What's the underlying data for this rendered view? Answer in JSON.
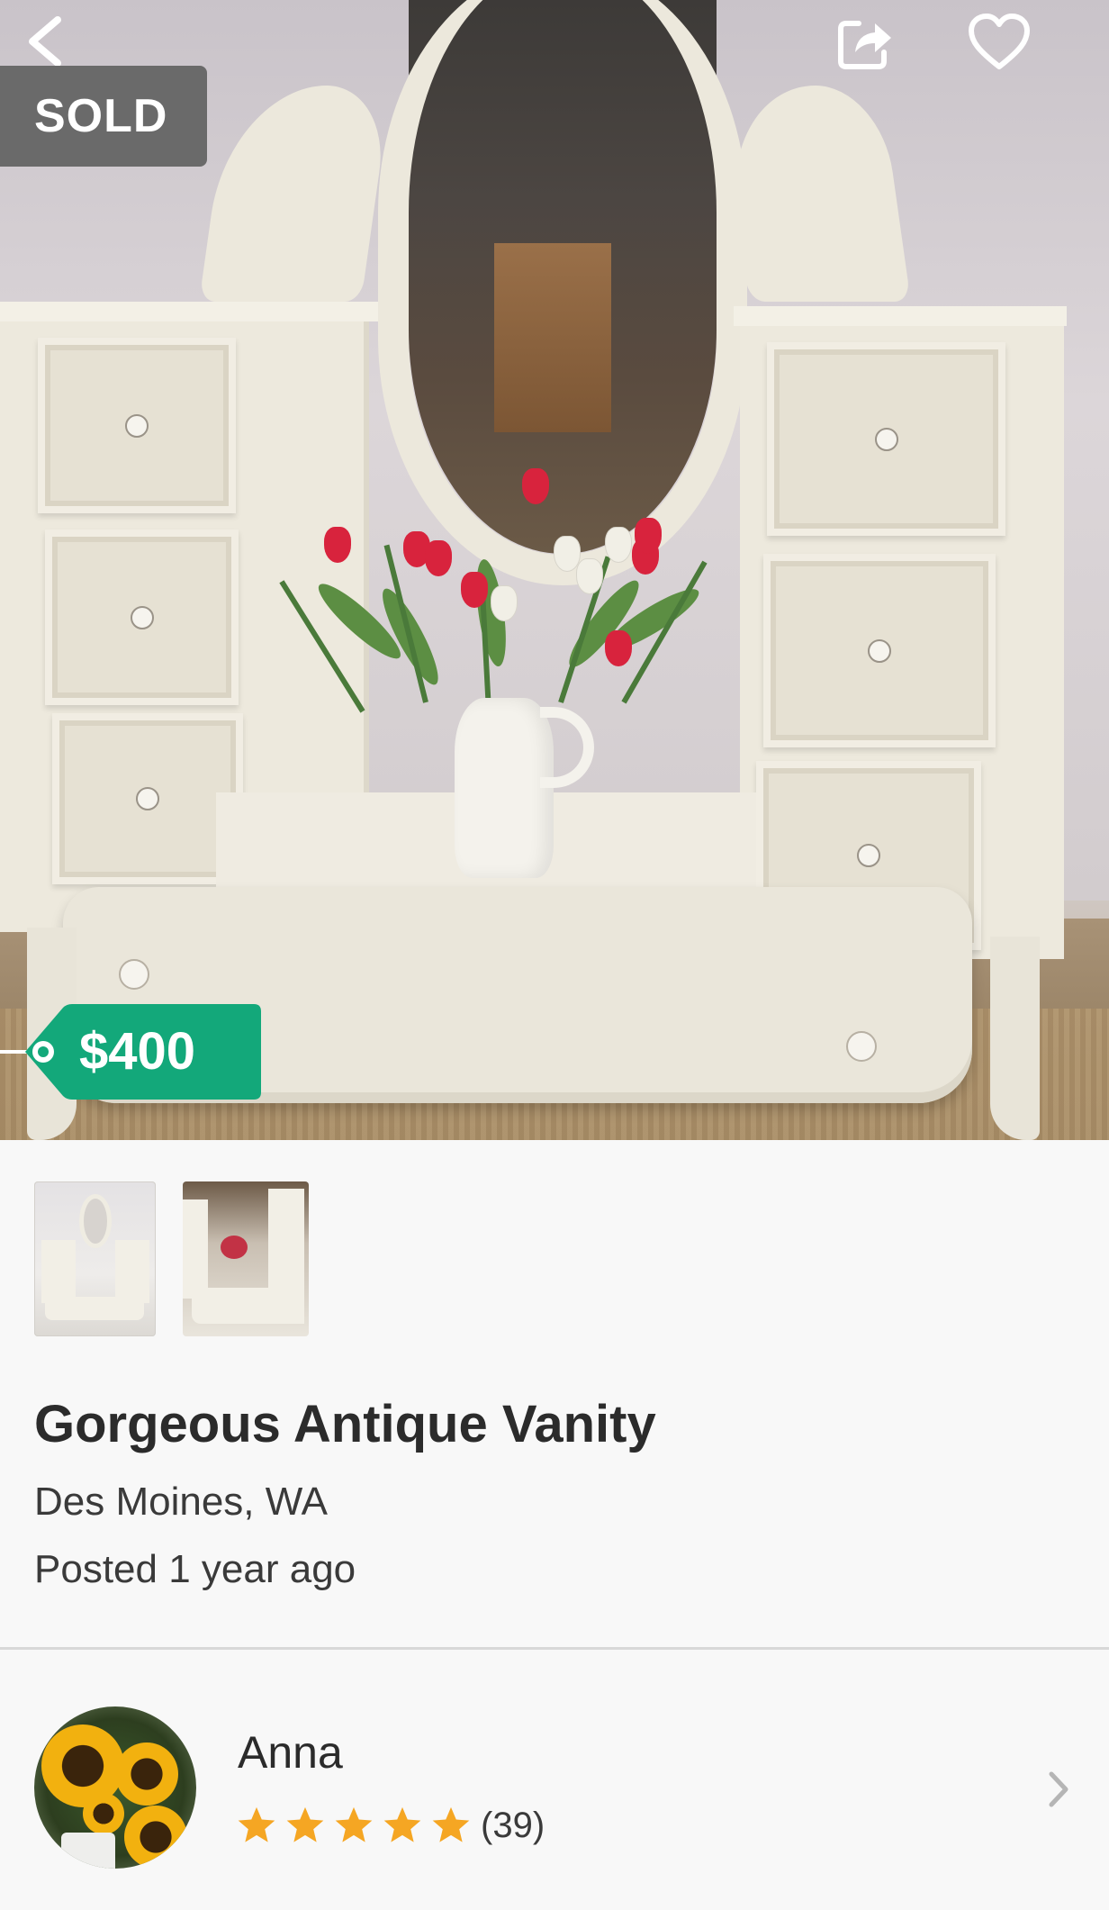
{
  "listing": {
    "status_badge": "SOLD",
    "price": "$400",
    "title": "Gorgeous Antique Vanity",
    "location": "Des Moines, WA",
    "posted": "Posted 1 year ago"
  },
  "seller": {
    "name": "Anna",
    "rating_stars": 5,
    "rating_count": "(39)"
  },
  "icons": {
    "back": "back-arrow-icon",
    "share": "share-icon",
    "favorite": "heart-icon",
    "chevron": "chevron-right-icon",
    "star": "star-icon"
  },
  "colors": {
    "price_tag": "#13a87a",
    "sold_badge": "#6a6a6a",
    "star": "#f5a623",
    "divider": "#d8d8d8"
  }
}
